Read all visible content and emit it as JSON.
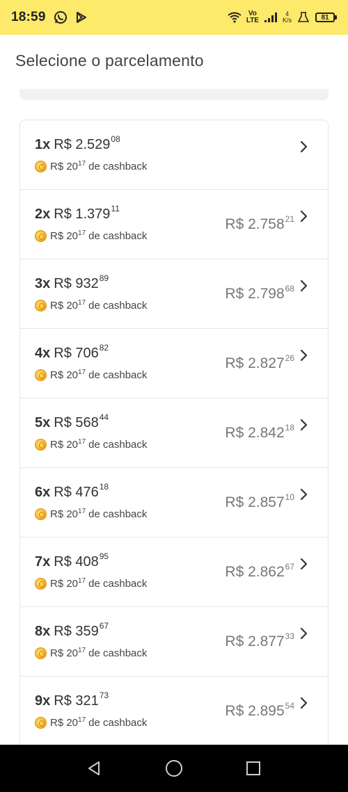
{
  "status_bar": {
    "time": "18:59",
    "network_label_top": "Vo",
    "network_label_bottom": "LTE",
    "speed_value": "4",
    "speed_unit": "K/s",
    "battery": "81",
    "icons": [
      "whatsapp-icon",
      "play-store-icon",
      "wifi-icon",
      "signal-icon",
      "lab-icon",
      "battery-icon"
    ]
  },
  "header": {
    "title": "Selecione o parcelamento"
  },
  "installments": [
    {
      "count": "1",
      "x": "x",
      "amount": "R$ 2.529",
      "cents": "08",
      "total": "",
      "total_cents": "",
      "cashback_amount": "R$ 20",
      "cashback_cents": "17",
      "cashback_label": "de cashback"
    },
    {
      "count": "2",
      "x": "x",
      "amount": "R$ 1.379",
      "cents": "11",
      "total": "R$ 2.758",
      "total_cents": "21",
      "cashback_amount": "R$ 20",
      "cashback_cents": "17",
      "cashback_label": "de cashback"
    },
    {
      "count": "3",
      "x": "x",
      "amount": "R$ 932",
      "cents": "89",
      "total": "R$ 2.798",
      "total_cents": "68",
      "cashback_amount": "R$ 20",
      "cashback_cents": "17",
      "cashback_label": "de cashback"
    },
    {
      "count": "4",
      "x": "x",
      "amount": "R$ 706",
      "cents": "82",
      "total": "R$ 2.827",
      "total_cents": "26",
      "cashback_amount": "R$ 20",
      "cashback_cents": "17",
      "cashback_label": "de cashback"
    },
    {
      "count": "5",
      "x": "x",
      "amount": "R$ 568",
      "cents": "44",
      "total": "R$ 2.842",
      "total_cents": "18",
      "cashback_amount": "R$ 20",
      "cashback_cents": "17",
      "cashback_label": "de cashback"
    },
    {
      "count": "6",
      "x": "x",
      "amount": "R$ 476",
      "cents": "18",
      "total": "R$ 2.857",
      "total_cents": "10",
      "cashback_amount": "R$ 20",
      "cashback_cents": "17",
      "cashback_label": "de cashback"
    },
    {
      "count": "7",
      "x": "x",
      "amount": "R$ 408",
      "cents": "95",
      "total": "R$ 2.862",
      "total_cents": "67",
      "cashback_amount": "R$ 20",
      "cashback_cents": "17",
      "cashback_label": "de cashback"
    },
    {
      "count": "8",
      "x": "x",
      "amount": "R$ 359",
      "cents": "67",
      "total": "R$ 2.877",
      "total_cents": "33",
      "cashback_amount": "R$ 20",
      "cashback_cents": "17",
      "cashback_label": "de cashback"
    },
    {
      "count": "9",
      "x": "x",
      "amount": "R$ 321",
      "cents": "73",
      "total": "R$ 2.895",
      "total_cents": "54",
      "cashback_amount": "R$ 20",
      "cashback_cents": "17",
      "cashback_label": "de cashback"
    }
  ],
  "nav_bar": {
    "icons": [
      "back-icon",
      "home-icon",
      "recents-icon"
    ]
  },
  "colors": {
    "status_bar": "#fde96a",
    "coin": "#f6b72a",
    "nav_bar": "#000000"
  }
}
